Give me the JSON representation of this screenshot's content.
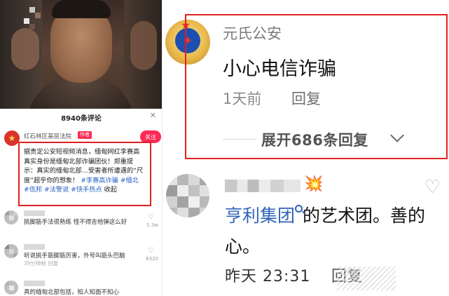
{
  "left_panel": {
    "comment_count": "8940条评论",
    "close_glyph": "✕",
    "pinned_comment": {
      "account": "红石林区基层法院",
      "author_tag": "作者",
      "follow_label": "关注",
      "text_main": "据贵定公安短视频消息，缅甸网红李赛高真实身份是缅甸北部诈骗团伙！郑重提示：真实的缅甸北部…受害者所遭遇的“尺度”超乎你的想象！",
      "hashtags": "#李赛高诈骗 #缅北 #佤邦 #法警说 #快手热点",
      "collapse_label": "收起"
    },
    "comments": [
      {
        "text": "挑脚筋手法很熟练 怪不得吉他弹这么好",
        "meta": "",
        "likes": "1.3w"
      },
      {
        "text": "听说挑手筋脚筋厉害，外号叫筋头巴脑",
        "meta": "39分钟前 回复",
        "likes": "6320"
      },
      {
        "text": "真的缅甸北部包括，知人知面不知心",
        "meta": "",
        "likes": ""
      }
    ]
  },
  "right_panel": {
    "highlighted_reply": {
      "account": "元氏公安",
      "text": "小心电信诈骗",
      "time": "1天前",
      "reply_label": "回复",
      "expand_label": "展开686条回复"
    },
    "second_comment": {
      "link_text": "亨利集团",
      "text_after_link": "的艺术团。善的心。",
      "time": "昨天 23:31",
      "reply_label": "回复"
    }
  },
  "icons": {
    "heart": "heart-icon",
    "fire": "fire-emoji-icon",
    "search": "search-icon",
    "chevron": "chevron-down-icon",
    "police_emblem": "police-emblem-avatar"
  },
  "colors": {
    "highlight_border": "#e02020",
    "follow_button": "#ff2a55",
    "hashtag_blue": "#2b62c4",
    "link_blue": "#2f63b8"
  }
}
